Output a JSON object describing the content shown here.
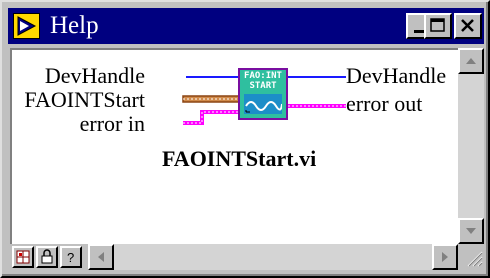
{
  "window": {
    "title": "Help"
  },
  "diagram": {
    "inputs": {
      "devhandle": "DevHandle",
      "faointstart": "FAOINTStart",
      "error_in": "error in"
    },
    "outputs": {
      "devhandle": "DevHandle",
      "error_out": "error out"
    },
    "icon": {
      "line1": "FAO:INT",
      "line2": "START"
    },
    "vi_name": "FAOINTStart.vi"
  },
  "colors": {
    "titlebar": "#000080",
    "refnum_wire": "#1a1aff",
    "cluster_wire": "#a0522d",
    "error_wire": "#ff00ff",
    "icon_fill": "#2fbf9f"
  },
  "icons": {
    "app": "labview-run-icon",
    "minimize": "minimize-icon",
    "maximize": "maximize-icon",
    "close": "close-icon",
    "scroll_up": "arrow-up-icon",
    "scroll_down": "arrow-down-icon",
    "scroll_left": "arrow-left-icon",
    "scroll_right": "arrow-right-icon",
    "tools": [
      "show-block-diagram-icon",
      "lock-icon",
      "question-icon"
    ]
  }
}
